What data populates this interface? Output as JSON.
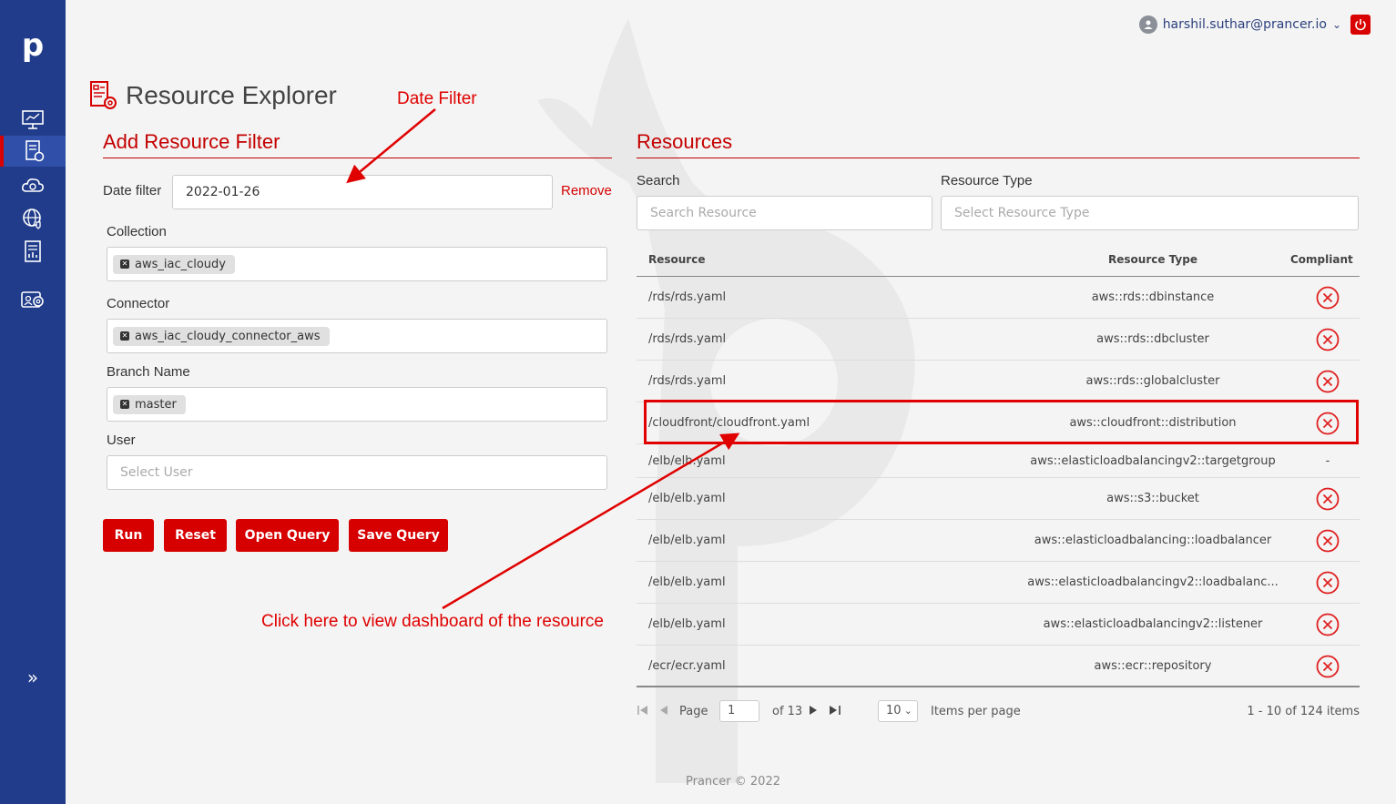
{
  "brand": {
    "logo": "p",
    "accent": "#d60000",
    "sidebar_color": "#203c8a"
  },
  "header": {
    "user_email": "harshil.suthar@prancer.io"
  },
  "page": {
    "title": "Resource Explorer"
  },
  "annotations": {
    "date_filter": "Date Filter",
    "click_here": "Click here to view dashboard of the resource"
  },
  "filter": {
    "heading": "Add Resource Filter",
    "date_label": "Date filter",
    "date_value": "2022-01-26",
    "remove_label": "Remove",
    "collection_label": "Collection",
    "collection_chip": "aws_iac_cloudy",
    "connector_label": "Connector",
    "connector_chip": "aws_iac_cloudy_connector_aws",
    "branch_label": "Branch Name",
    "branch_chip": "master",
    "user_label": "User",
    "user_placeholder": "Select User",
    "buttons": {
      "run": "Run",
      "reset": "Reset",
      "open_query": "Open Query",
      "save_query": "Save Query"
    }
  },
  "resources": {
    "heading": "Resources",
    "search_label": "Search",
    "search_placeholder": "Search Resource",
    "type_label": "Resource Type",
    "type_placeholder": "Select Resource Type",
    "columns": {
      "resource": "Resource",
      "type": "Resource Type",
      "compliant": "Compliant"
    },
    "rows": [
      {
        "resource": "/rds/rds.yaml",
        "type": "aws::rds::dbinstance",
        "compliant": "x"
      },
      {
        "resource": "/rds/rds.yaml",
        "type": "aws::rds::dbcluster",
        "compliant": "x"
      },
      {
        "resource": "/rds/rds.yaml",
        "type": "aws::rds::globalcluster",
        "compliant": "x"
      },
      {
        "resource": "/cloudfront/cloudfront.yaml",
        "type": "aws::cloudfront::distribution",
        "compliant": "x"
      },
      {
        "resource": "/elb/elb.yaml",
        "type": "aws::elasticloadbalancingv2::targetgroup",
        "compliant": "-"
      },
      {
        "resource": "/elb/elb.yaml",
        "type": "aws::s3::bucket",
        "compliant": "x"
      },
      {
        "resource": "/elb/elb.yaml",
        "type": "aws::elasticloadbalancing::loadbalancer",
        "compliant": "x"
      },
      {
        "resource": "/elb/elb.yaml",
        "type": "aws::elasticloadbalancingv2::loadbalanc...",
        "compliant": "x"
      },
      {
        "resource": "/elb/elb.yaml",
        "type": "aws::elasticloadbalancingv2::listener",
        "compliant": "x"
      },
      {
        "resource": "/ecr/ecr.yaml",
        "type": "aws::ecr::repository",
        "compliant": "x"
      }
    ],
    "pager": {
      "page_label": "Page",
      "page_value": "1",
      "of_label": "of 13",
      "per_page_value": "10",
      "per_page_label": "Items per page",
      "range_label": "1 - 10 of 124 items"
    }
  },
  "footer": {
    "text": "Prancer © 2022"
  }
}
